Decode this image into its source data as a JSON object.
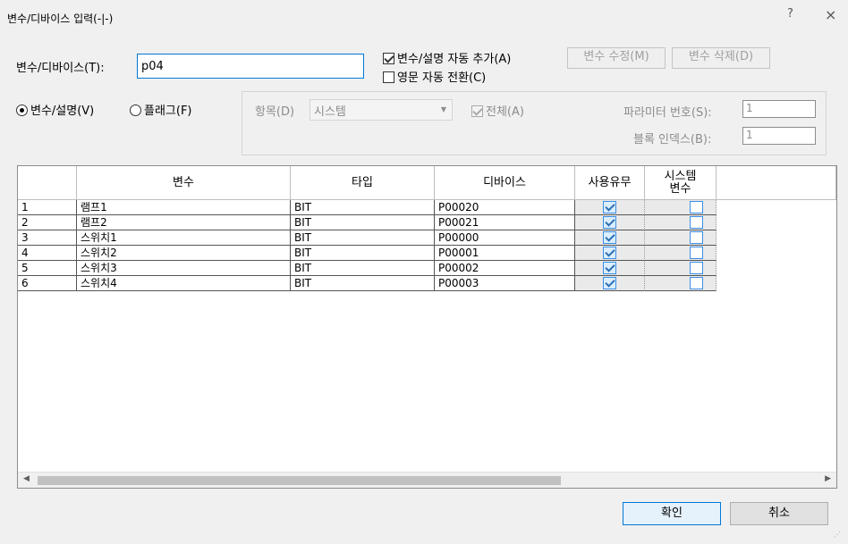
{
  "window": {
    "title": "변수/디바이스 입력(-|-)",
    "help_label": "?",
    "close_label": "×"
  },
  "form": {
    "var_label": "변수/디바이스(T):",
    "var_value": "p04",
    "auto_add_label": "변수/설명 자동 추가(A)",
    "auto_add_checked": true,
    "english_label": "영문 자동 전환(C)",
    "english_checked": false,
    "modify_button": "변수 수정(M)",
    "delete_button": "변수 삭제(D)",
    "radio_var_label": "변수/설명(V)",
    "radio_flag_label": "플래그(F)",
    "selected_radio": "var"
  },
  "group": {
    "item_label": "항목(D)",
    "item_value": "시스템",
    "all_label": "전체(A)",
    "param_label": "파라미터 번호(S):",
    "param_value": "1",
    "block_label": "블록 인덱스(B):",
    "block_value": "1"
  },
  "table": {
    "columns": [
      "",
      "변수",
      "타입",
      "디바이스",
      "사용유무",
      "시스템\n변수"
    ],
    "rows": [
      {
        "num": "1",
        "var": "램프1",
        "type": "BIT",
        "device": "P00020",
        "used": true,
        "system": false
      },
      {
        "num": "2",
        "var": "램프2",
        "type": "BIT",
        "device": "P00021",
        "used": true,
        "system": false
      },
      {
        "num": "3",
        "var": "스위치1",
        "type": "BIT",
        "device": "P00000",
        "used": true,
        "system": false
      },
      {
        "num": "4",
        "var": "스위치2",
        "type": "BIT",
        "device": "P00001",
        "used": true,
        "system": false
      },
      {
        "num": "5",
        "var": "스위치3",
        "type": "BIT",
        "device": "P00002",
        "used": true,
        "system": false
      },
      {
        "num": "6",
        "var": "스위치4",
        "type": "BIT",
        "device": "P00003",
        "used": true,
        "system": false
      }
    ]
  },
  "footer": {
    "ok_button": "확인",
    "cancel_button": "취소"
  },
  "colors": {
    "accent": "#0078d7",
    "checkbox_blue": "#3a8ee6"
  }
}
